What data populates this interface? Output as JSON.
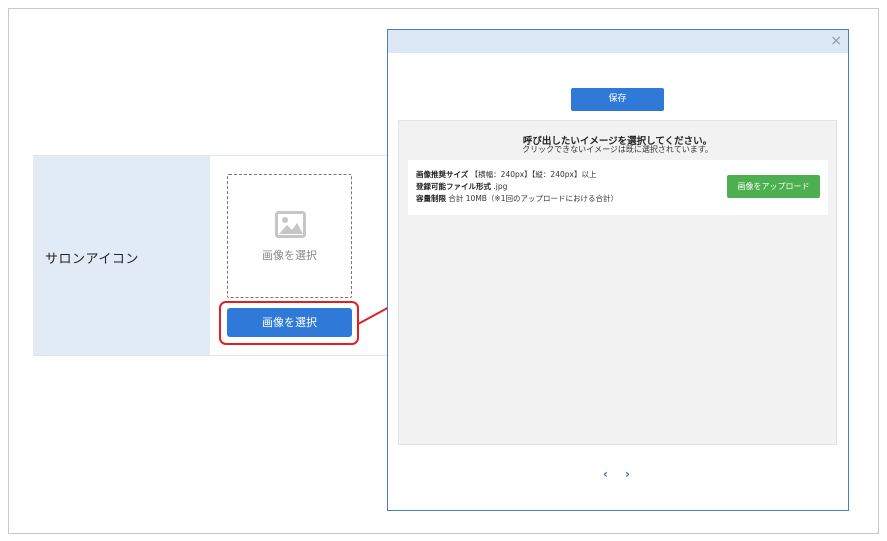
{
  "form": {
    "label": "サロンアイコン",
    "drop_label": "画像を選択",
    "select_button": "画像を選択"
  },
  "modal": {
    "close": "×",
    "save_button": "保存",
    "title": "呼び出したいイメージを選択してください。",
    "subtitle": "クリックできないイメージは既に選択されています。",
    "info": {
      "size_label": "画像推奨サイズ",
      "size_value": "【横幅：240px】【縦：240px】以上",
      "format_label": "登録可能ファイル形式",
      "format_value": ".jpg",
      "capacity_label": "容量制限",
      "capacity_value": "合計 10MB（※1回のアップロードにおける合計）"
    },
    "upload_button": "画像をアップロード",
    "pager": {
      "prev": "‹",
      "next": "›"
    }
  },
  "colors": {
    "primary_blue": "#2f7ad8",
    "upload_green": "#4caf50",
    "highlight_red": "#e02020",
    "label_bg": "#e1ebf6",
    "modal_header_bg": "#dce8f6"
  },
  "icons": {
    "image_placeholder": "image-icon",
    "close": "close-icon",
    "arrow": "arrow-right-icon"
  }
}
